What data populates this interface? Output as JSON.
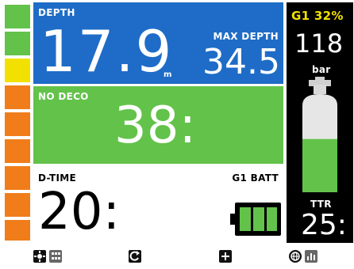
{
  "ascent_bar": {
    "segments": [
      {
        "color": "#63c24a"
      },
      {
        "color": "#63c24a"
      },
      {
        "color": "#f2e100"
      },
      {
        "color": "#f07d1a"
      },
      {
        "color": "#f07d1a"
      },
      {
        "color": "#f07d1a"
      },
      {
        "color": "#f07d1a"
      },
      {
        "color": "#f07d1a"
      },
      {
        "color": "#f07d1a"
      }
    ]
  },
  "depth": {
    "label": "DEPTH",
    "value": "17.9",
    "unit": "m",
    "max_label": "MAX DEPTH",
    "max_value": "34.5"
  },
  "nodeco": {
    "label": "NO DECO",
    "value": "38:"
  },
  "dtime": {
    "label": "D-TIME",
    "value": "20:",
    "batt_label": "G1 BATT",
    "battery_bars": 3
  },
  "gas": {
    "label": "G1 32%",
    "pressure": "118",
    "unit": "bar",
    "ttr_label": "TTR",
    "ttr_value": "25:",
    "tank_fill_fraction": 0.58
  },
  "bottom_icons": [
    {
      "name": "light-icon"
    },
    {
      "name": "grid-icon"
    },
    {
      "name": "cycle-icon"
    },
    {
      "name": "plus-icon"
    },
    {
      "name": "globe-icon"
    },
    {
      "name": "chart-icon"
    }
  ],
  "colors": {
    "depth_bg": "#1e6cc7",
    "nodeco_bg": "#63c24a",
    "gas_label": "#f2e100",
    "battery": "#63c24a"
  }
}
